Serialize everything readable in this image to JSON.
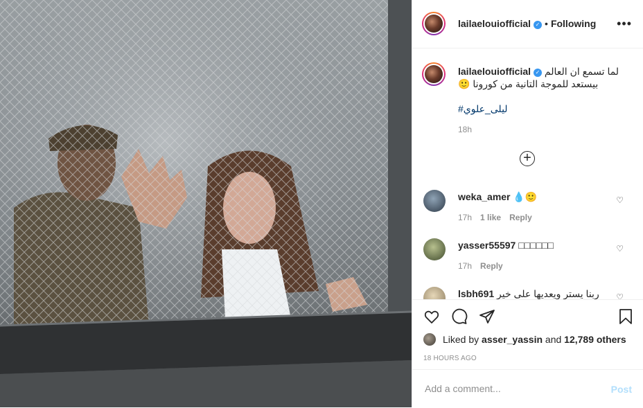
{
  "post": {
    "username": "lailaelouiofficial",
    "follow_status": "Following",
    "separator": "•",
    "more_glyph": "•••",
    "caption_line1": "لما تسمع ان العالم",
    "caption_line2": "بيستعد للموجة التانية من كورونا 🙂",
    "hashtag": "#ليلى_علوي",
    "caption_time": "18h",
    "load_more_glyph": "+"
  },
  "comments": [
    {
      "username": "weka_amer",
      "text": "💧🙂",
      "time": "17h",
      "likes": "1 like",
      "reply": "Reply"
    },
    {
      "username": "yasser55597",
      "text": "□□□□□□",
      "time": "17h",
      "likes": "",
      "reply": "Reply"
    },
    {
      "username": "lsbh691",
      "text": "ربنا يستر ويعديها على خير",
      "time": "",
      "likes": "",
      "reply": ""
    }
  ],
  "actions": {
    "liked_prefix": "Liked by",
    "liked_user": "asser_yassin",
    "liked_and": "and",
    "liked_count": "12,789 others",
    "time_ago": "18 HOURS AGO"
  },
  "comment_box": {
    "placeholder": "Add a comment...",
    "post_label": "Post"
  },
  "colors": {
    "verified": "#3897f0",
    "post_disabled": "#b2dffc",
    "hashtag": "#00376b"
  },
  "icons": [
    "verified-badge-icon",
    "more-options-icon",
    "load-more-icon",
    "heart-icon",
    "comment-icon",
    "share-icon",
    "bookmark-icon"
  ]
}
